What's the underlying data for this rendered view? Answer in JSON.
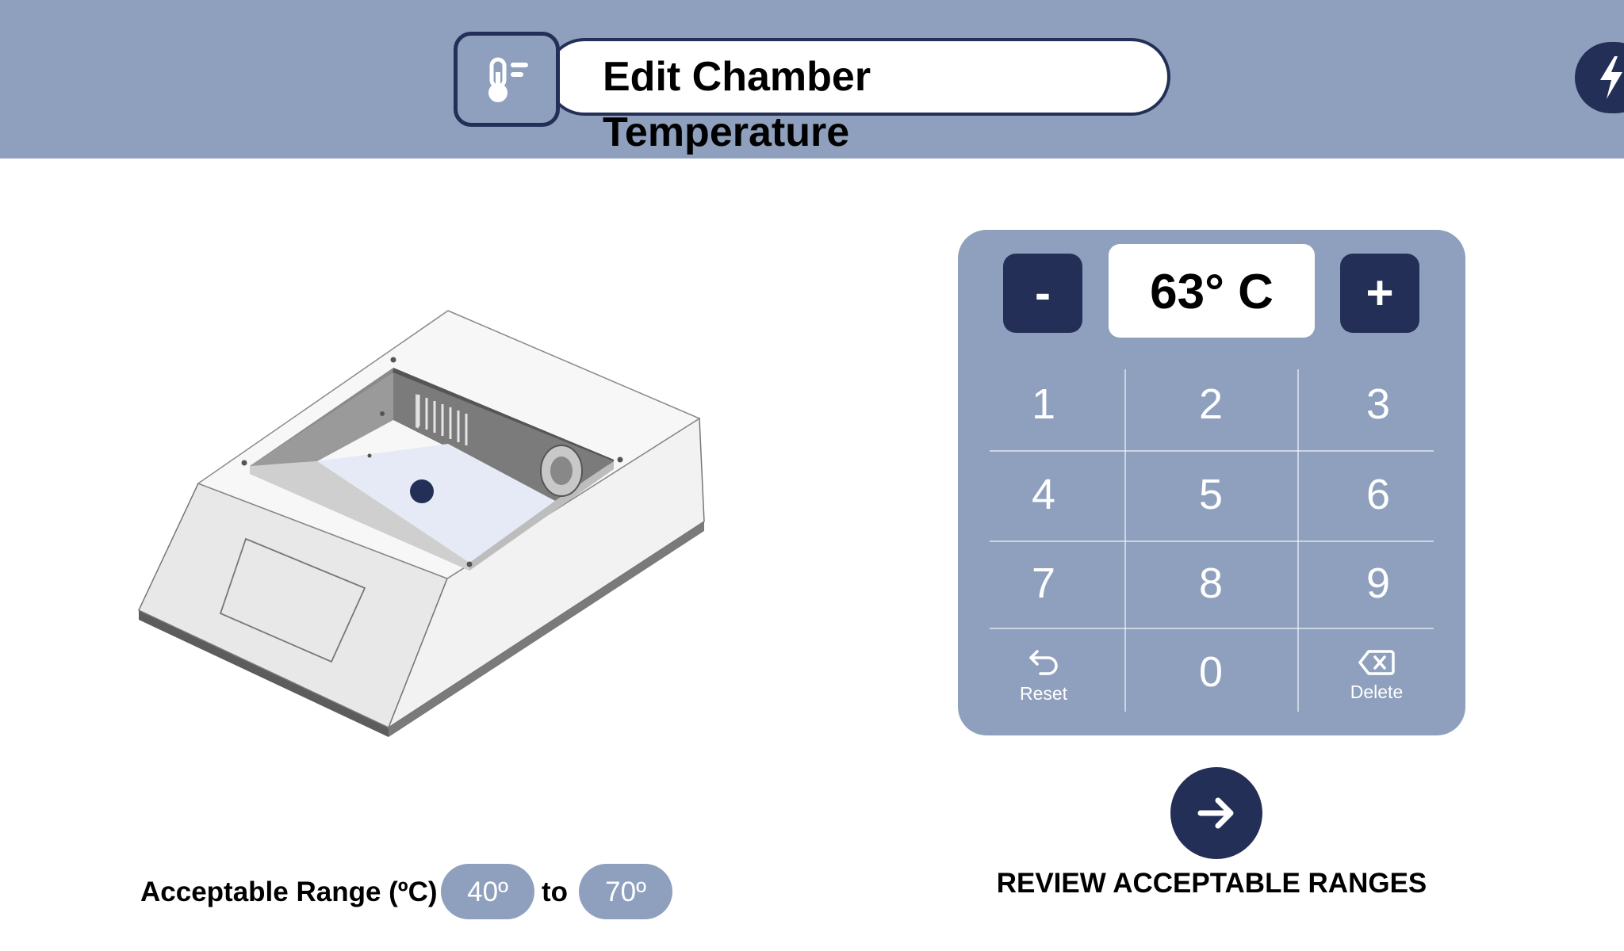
{
  "header": {
    "title": "Edit Chamber Temperature",
    "title_icon": "thermometer-icon",
    "action_icon": "lightning-bolt-icon"
  },
  "colors": {
    "header_bg": "#8ea0bd",
    "accent_dark": "#232f57",
    "chamber_tray": "#e6eaf6",
    "sample_dot": "#232f57"
  },
  "keypad": {
    "decrement_label": "-",
    "increment_label": "+",
    "temperature_display": "63° C",
    "keys": [
      {
        "label": "1"
      },
      {
        "label": "2"
      },
      {
        "label": "3"
      },
      {
        "label": "4"
      },
      {
        "label": "5"
      },
      {
        "label": "6"
      },
      {
        "label": "7"
      },
      {
        "label": "8"
      },
      {
        "label": "9"
      }
    ],
    "reset_label": "Reset",
    "reset_icon": "undo-arrow-icon",
    "zero_label": "0",
    "delete_label": "Delete",
    "delete_icon": "backspace-icon"
  },
  "range": {
    "label": "Acceptable Range (ºC)",
    "min": "40º",
    "separator": "to",
    "max": "70º"
  },
  "review": {
    "label": "REVIEW ACCEPTABLE RANGES",
    "icon": "arrow-right-icon"
  }
}
